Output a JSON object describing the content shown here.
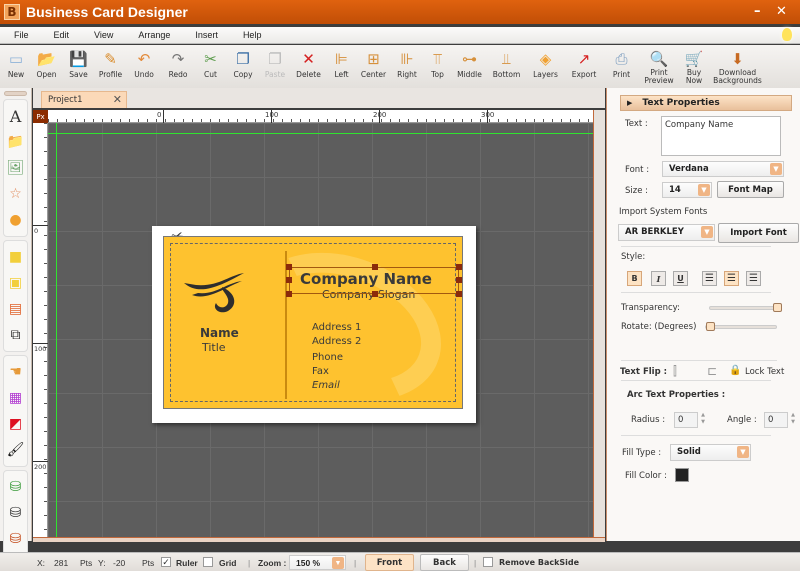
{
  "window": {
    "logo_letter": "B",
    "title": "Business Card Designer",
    "minimize": "–",
    "close": "✕"
  },
  "menu": [
    "File",
    "Edit",
    "View",
    "Arrange",
    "Insert",
    "Help"
  ],
  "toolbar": [
    {
      "label": "New",
      "icon": "new-icon",
      "glyph": "▭",
      "color": "#8fb3d9"
    },
    {
      "label": "Open",
      "icon": "open-folder-icon",
      "glyph": "📂",
      "color": "#f0b429"
    },
    {
      "label": "Save",
      "icon": "save-icon",
      "glyph": "💾",
      "color": "#222"
    },
    {
      "label": "Profile",
      "icon": "profile-icon",
      "glyph": "✎",
      "color": "#d98b2b"
    },
    {
      "label": "Undo",
      "icon": "undo-icon",
      "glyph": "↶",
      "color": "#e38a3a"
    },
    {
      "label": "Redo",
      "icon": "redo-icon",
      "glyph": "↷",
      "color": "#777"
    },
    {
      "label": "Cut",
      "icon": "cut-icon",
      "glyph": "✂",
      "color": "#5a9b4a"
    },
    {
      "label": "Copy",
      "icon": "copy-icon",
      "glyph": "❐",
      "color": "#3b6ea5"
    },
    {
      "label": "Paste",
      "icon": "paste-icon",
      "glyph": "❐",
      "color": "#bbb",
      "disabled": true
    },
    {
      "label": "Delete",
      "icon": "delete-icon",
      "glyph": "✕",
      "color": "#d42020"
    },
    {
      "label": "Left",
      "icon": "align-left-icon",
      "glyph": "⊫",
      "color": "#d6903b"
    },
    {
      "label": "Center",
      "icon": "align-center-icon",
      "glyph": "⊞",
      "color": "#d6903b"
    },
    {
      "label": "Right",
      "icon": "align-right-icon",
      "glyph": "⊪",
      "color": "#d6903b"
    },
    {
      "label": "Top",
      "icon": "align-top-icon",
      "glyph": "⫪",
      "color": "#d6903b"
    },
    {
      "label": "Middle",
      "icon": "align-middle-icon",
      "glyph": "⊶",
      "color": "#d6903b"
    },
    {
      "label": "Bottom",
      "icon": "align-bottom-icon",
      "glyph": "⫫",
      "color": "#d6903b"
    },
    {
      "label": "Layers",
      "icon": "layers-icon",
      "glyph": "◈",
      "color": "#f0a030"
    },
    {
      "label": "Export",
      "icon": "export-icon",
      "glyph": "↗",
      "color": "#d62020"
    },
    {
      "label": "Print",
      "icon": "print-icon",
      "glyph": "⎙",
      "color": "#7a9cbf"
    },
    {
      "label": "Print\nPreview",
      "icon": "print-preview-icon",
      "glyph": "🔍",
      "color": "#5a7fa5"
    },
    {
      "label": "Buy\nNow",
      "icon": "cart-icon",
      "glyph": "🛒",
      "color": "#555"
    },
    {
      "label": "Download\nBackgrounds",
      "icon": "download-backgrounds-icon",
      "glyph": "⬇",
      "color": "#c76a22"
    }
  ],
  "left_tools": [
    [
      {
        "name": "text-tool",
        "icon": "text-icon",
        "glyph": "A",
        "color": "#333"
      },
      {
        "name": "open-image-tool",
        "icon": "image-folder-icon",
        "glyph": "📁",
        "color": "#e6b43c"
      },
      {
        "name": "insert-picture-tool",
        "icon": "picture-icon",
        "glyph": "🖼",
        "color": "#6aa36a"
      },
      {
        "name": "shapes-tool",
        "icon": "star-shape-icon",
        "glyph": "☆",
        "color": "#e08a5a"
      },
      {
        "name": "clipart-tool",
        "icon": "clipart-icon",
        "glyph": "●",
        "color": "#f0a030"
      }
    ],
    [
      {
        "name": "bring-front-tool",
        "icon": "bring-to-front-icon",
        "glyph": "■",
        "color": "#f2cf3c"
      },
      {
        "name": "send-back-tool",
        "icon": "send-to-back-icon",
        "glyph": "▣",
        "color": "#f2cf3c"
      },
      {
        "name": "template-tool",
        "icon": "template-icon",
        "glyph": "▤",
        "color": "#e0622a"
      },
      {
        "name": "group-tool",
        "icon": "group-icon",
        "glyph": "⧉",
        "color": "#333"
      }
    ],
    [
      {
        "name": "hand-tool",
        "icon": "hand-icon",
        "glyph": "☚",
        "color": "#e69a3a"
      },
      {
        "name": "color-tool",
        "icon": "color-palette-icon",
        "glyph": "▦",
        "color": "#b03ad0"
      },
      {
        "name": "fill-tool",
        "icon": "fill-icon",
        "glyph": "◩",
        "color": "#d12"
      },
      {
        "name": "brush-tool",
        "icon": "brush-icon",
        "glyph": "🖌",
        "color": "#111"
      }
    ],
    [
      {
        "name": "add-database-tool",
        "icon": "database-add-icon",
        "glyph": "⛁",
        "color": "#3a9a3a"
      },
      {
        "name": "database-info-tool",
        "icon": "database-info-icon",
        "glyph": "⛁",
        "color": "#333"
      },
      {
        "name": "delete-database-tool",
        "icon": "database-delete-icon",
        "glyph": "⛁",
        "color": "#c34a1a"
      }
    ]
  ],
  "tab": {
    "label": "Project1",
    "close": "✕"
  },
  "ruler": {
    "unit": "Px",
    "h_labels": [
      "0",
      "100",
      "200",
      "300"
    ],
    "v_labels": [
      "0",
      "100",
      "200"
    ]
  },
  "card": {
    "company_name": "Company Name",
    "slogan": "Company Slogan",
    "name": "Name",
    "title": "Title",
    "address1": "Address 1",
    "address2": "Address 2",
    "phone": "Phone",
    "fax": "Fax",
    "email": "Email",
    "background_color": "#fec22f"
  },
  "properties": {
    "header": "Text Properties",
    "text_label": "Text :",
    "text_value": "Company Name",
    "font_label": "Font :",
    "font_value": "Verdana",
    "size_label": "Size :",
    "size_value": "14",
    "font_map": "Font Map",
    "import_label": "Import System Fonts",
    "import_font_value": "AR BERKLEY",
    "import_font_button": "Import Font",
    "style_label": "Style:",
    "bold": "B",
    "italic": "I",
    "underline": "U",
    "transparency_label": "Transparency:",
    "transparency_value": 1.0,
    "rotate_label": "Rotate: (Degrees)",
    "rotate_value": 0,
    "text_flip_label": "Text Flip :",
    "lock_text": "Lock Text",
    "arc_label": "Arc Text Properties :",
    "radius_label": "Radius :",
    "radius_value": "0",
    "angle_label": "Angle :",
    "angle_value": "0",
    "fill_type_label": "Fill Type :",
    "fill_type_value": "Solid",
    "fill_color_label": "Fill Color :",
    "fill_color": "#222222"
  },
  "status": {
    "x_label": "X:",
    "x_value": "281",
    "x_unit": "Pts",
    "y_label": "Y:",
    "y_value": "-20",
    "y_unit": "Pts",
    "ruler_label": "Ruler",
    "ruler_checked": true,
    "grid_label": "Grid",
    "grid_checked": false,
    "zoom_label": "Zoom :",
    "zoom_value": "150 %",
    "front": "Front",
    "back": "Back",
    "remove_backside": "Remove BackSide"
  }
}
